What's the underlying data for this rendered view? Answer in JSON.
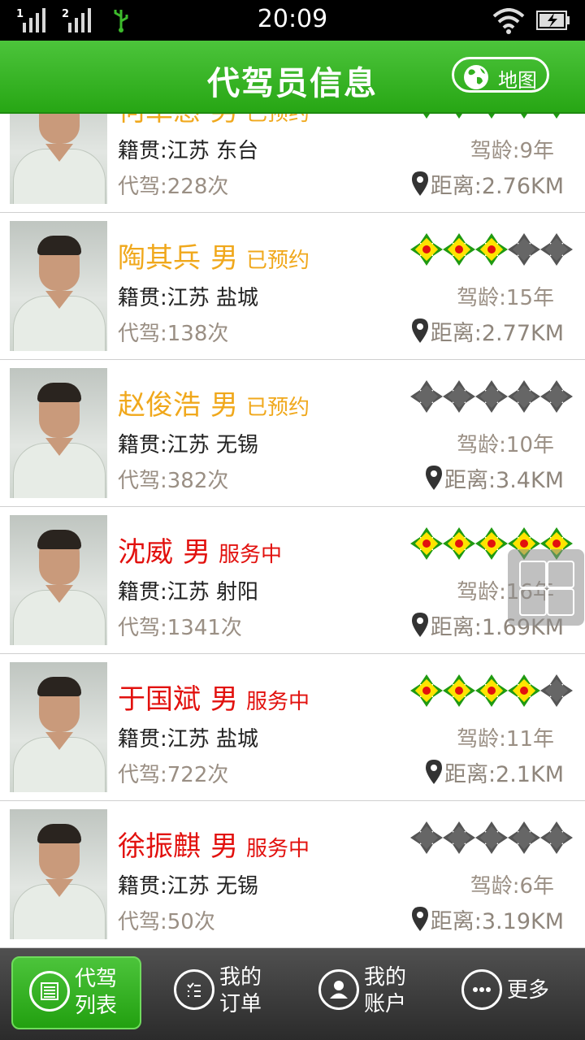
{
  "status_bar": {
    "time": "20:09",
    "sim1": "1",
    "sim2": "2",
    "icons": [
      "signal-icon",
      "signal-icon",
      "usb-icon",
      "wifi-icon",
      "battery-charging-icon"
    ]
  },
  "header": {
    "title": "代驾员信息",
    "map_label": "地图",
    "accent": "#31b01f"
  },
  "drivers": [
    {
      "name": "何卓惠",
      "gender": "男",
      "status": "已预约",
      "status_type": "reserved",
      "origin": "籍贯:江苏 东台",
      "count": "代驾:228次",
      "age": "驾龄:9年",
      "distance": "距离:2.76KM",
      "rating": 5
    },
    {
      "name": "陶其兵",
      "gender": "男",
      "status": "已预约",
      "status_type": "reserved",
      "origin": "籍贯:江苏 盐城",
      "count": "代驾:138次",
      "age": "驾龄:15年",
      "distance": "距离:2.77KM",
      "rating": 3
    },
    {
      "name": "赵俊浩",
      "gender": "男",
      "status": "已预约",
      "status_type": "reserved",
      "origin": "籍贯:江苏 无锡",
      "count": "代驾:382次",
      "age": "驾龄:10年",
      "distance": "距离:3.4KM",
      "rating": 0
    },
    {
      "name": "沈威",
      "gender": "男",
      "status": "服务中",
      "status_type": "serving",
      "origin": "籍贯:江苏 射阳",
      "count": "代驾:1341次",
      "age": "驾龄:16年",
      "distance": "距离:1.69KM",
      "rating": 5
    },
    {
      "name": "于国斌",
      "gender": "男",
      "status": "服务中",
      "status_type": "serving",
      "origin": "籍贯:江苏 盐城",
      "count": "代驾:722次",
      "age": "驾龄:11年",
      "distance": "距离:2.1KM",
      "rating": 4
    },
    {
      "name": "徐振麒",
      "gender": "男",
      "status": "服务中",
      "status_type": "serving",
      "origin": "籍贯:江苏 无锡",
      "count": "代驾:50次",
      "age": "驾龄:6年",
      "distance": "距离:3.19KM",
      "rating": 0
    }
  ],
  "nav": [
    {
      "line1": "代驾",
      "line2": "列表",
      "icon": "list-icon",
      "active": true
    },
    {
      "line1": "我的",
      "line2": "订单",
      "icon": "order-icon",
      "active": false
    },
    {
      "line1": "我的",
      "line2": "账户",
      "icon": "account-icon",
      "active": false
    },
    {
      "line1": "更多",
      "line2": "",
      "icon": "more-icon",
      "active": false
    }
  ],
  "colors": {
    "reserved": "#f0a81c",
    "serving": "#e2110e",
    "star_on": "#ffe400",
    "star_off": "#555555"
  }
}
